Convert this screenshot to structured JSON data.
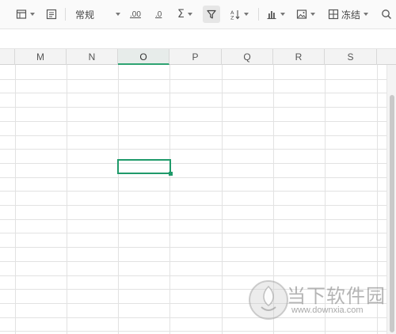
{
  "toolbar": {
    "number_format": "常规",
    "freeze_label": "冻结",
    "buttons": [
      "table-format-icon",
      "print-area-icon",
      "increase-decimal-icon",
      "decrease-decimal-icon",
      "sum-icon",
      "filter-icon",
      "sort-icon",
      "chart-icon",
      "image-icon",
      "freeze-icon",
      "search-icon"
    ],
    "increase_decimal_glyph": ".00",
    "decrease_decimal_glyph": ".0",
    "sum_glyph": "Σ"
  },
  "grid": {
    "columns": [
      "M",
      "N",
      "O",
      "P",
      "Q",
      "R",
      "S"
    ],
    "selected_column": "O",
    "active_cell": "O9",
    "accent_color": "#1f9a6a"
  },
  "watermark": {
    "title": "当下软件园",
    "url": "www.downxia.com"
  }
}
